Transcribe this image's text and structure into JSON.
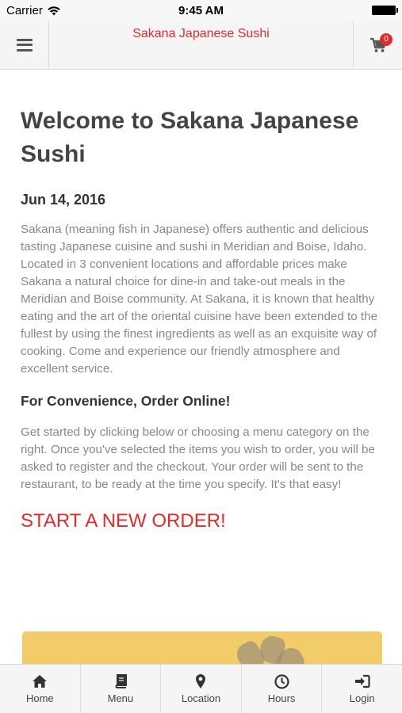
{
  "status_bar": {
    "carrier": "Carrier",
    "time": "9:45 AM"
  },
  "header": {
    "title": "Sakana Japanese Sushi",
    "cart_count": "0"
  },
  "main": {
    "heading": "Welcome to Sakana Japanese Sushi",
    "date": "Jun 14, 2016",
    "intro": "Sakana (meaning fish in Japanese) offers authentic and delicious tasting Japanese cuisine and sushi in Meridian and Boise, Idaho. Located in 3 convenient locations and affordable prices make Sakana a natural choice for dine-in and take-out meals in the Meridian and Boise community. At Sakana, it is known that healthy eating and the art of the oriental cuisine have been extended to the fullest by using the finest ingredients as well as an exquisite way of cooking. Come and experience our friendly atmosphere and excellent service.",
    "subheading": "For Convenience, Order Online!",
    "order_text": "Get started by clicking below or choosing a menu category on the right. Once you've selected the items you wish to order, you will be asked to register and the checkout. Your order will be sent to the restaurant, to be ready at the time you specify. It's that easy!",
    "cta": "START A NEW ORDER!"
  },
  "tabs": [
    {
      "label": "Home",
      "icon": "home-icon"
    },
    {
      "label": "Menu",
      "icon": "book-icon"
    },
    {
      "label": "Location",
      "icon": "map-marker-icon"
    },
    {
      "label": "Hours",
      "icon": "clock-icon"
    },
    {
      "label": "Login",
      "icon": "sign-in-icon"
    }
  ],
  "colors": {
    "accent": "#e32b2b",
    "banner": "#f3cc6a"
  }
}
